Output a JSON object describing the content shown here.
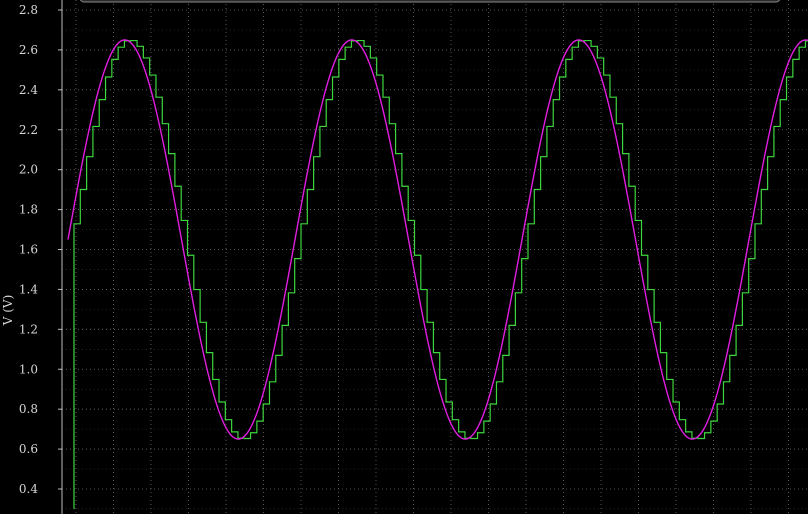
{
  "chart_data": {
    "type": "line",
    "title": "",
    "xlabel": "",
    "ylabel": "V (V)",
    "ylim": [
      0.3,
      2.8
    ],
    "yticks": [
      "2.8",
      "2.6",
      "2.4",
      "2.2",
      "2.0",
      "1.8",
      "1.6",
      "1.4",
      "1.2",
      "1.0",
      "0.8",
      "0.6",
      "0.4"
    ],
    "grid": true,
    "series": [
      {
        "id": "analog",
        "color": "#e01ee0",
        "shape": "sine",
        "offset_v": 1.65,
        "amplitude_v": 1.0,
        "cycles_shown": 3.35,
        "start_phase_fraction": 0.0
      },
      {
        "id": "sampled",
        "color": "#3ed63e",
        "shape": "sample-and-hold of analog",
        "steps_per_cycle": 36,
        "start_level_v": 0.3
      }
    ]
  }
}
